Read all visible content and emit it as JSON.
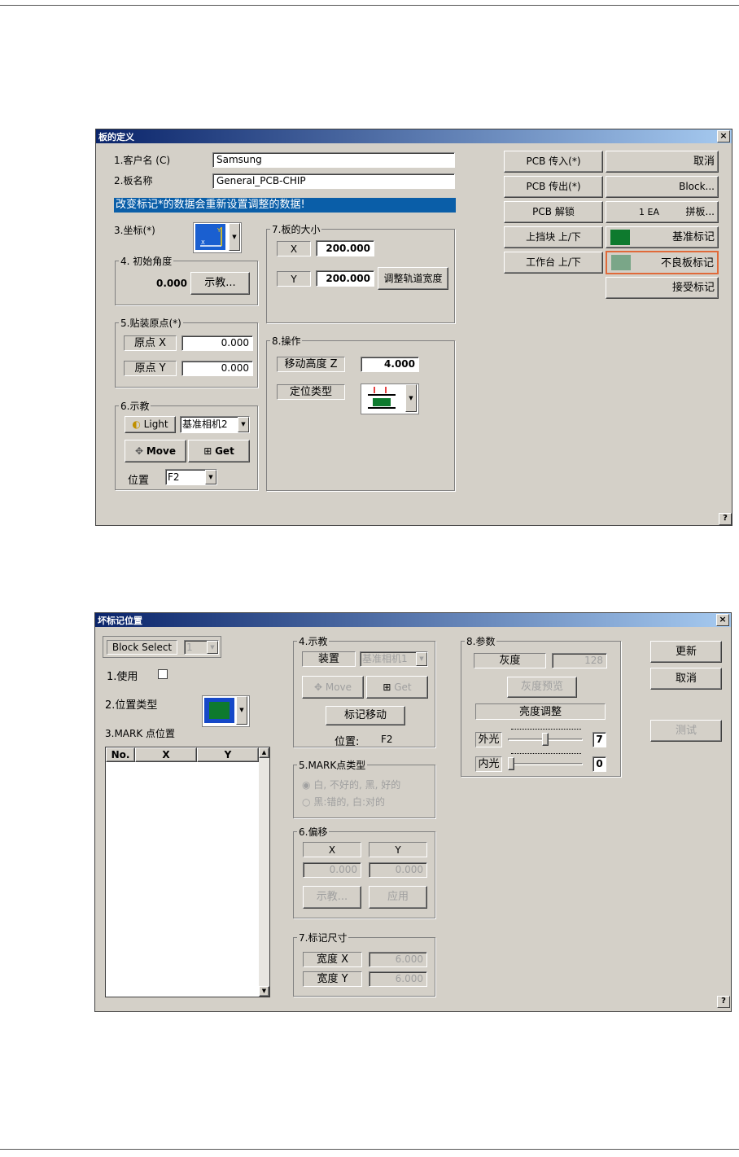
{
  "dialog1": {
    "title": "板的定义",
    "customer_label": "1.客户名 (C)",
    "customer_value": "Samsung",
    "board_name_label": "2.板名称",
    "board_name_value": "General_PCB-CHIP",
    "warning_banner": "改变标记*的数据会重新设置调整的数据!",
    "coord_label": "3.坐标(*)",
    "angle_group": "4. 初始角度",
    "angle_value": "0.000",
    "teach_button": "示教...",
    "origin_group": "5.贴装原点(*)",
    "origin_x_label": "原点 X",
    "origin_x_value": "0.000",
    "origin_y_label": "原点 Y",
    "origin_y_value": "0.000",
    "teach_group": "6.示教",
    "light_button": "Light",
    "camera_select": "基准相机2",
    "move_button": "Move",
    "get_button": "Get",
    "position_label": "位置",
    "position_select": "F2",
    "size_group": "7.板的大小",
    "x_label": "X",
    "x_value": "200.000",
    "y_label": "Y",
    "y_value": "200.000",
    "adjust_rail_button": "调整轨道宽度",
    "operation_group": "8.操作",
    "move_height_label": "移动高度 Z",
    "move_height_value": "4.000",
    "locate_type_label": "定位类型",
    "buttons_left": [
      "PCB 传入(*)",
      "PCB 传出(*)",
      "PCB 解锁",
      "上挡块 上/下",
      "工作台 上/下"
    ],
    "cancel_button": "取消",
    "block_button": "Block...",
    "panel_count": "1 EA",
    "panel_button": "拼板...",
    "fiducial_button": "基准标记",
    "bad_board_button": "不良板标记",
    "accept_button": "接受标记",
    "help": "?"
  },
  "dialog2": {
    "title": "坏标记位置",
    "block_select_label": "Block Select",
    "block_select_value": "1",
    "use_label": "1.使用",
    "position_type_label": "2.位置类型",
    "mark_pos_label": "3.MARK 点位置",
    "table_headers": [
      "No.",
      "X",
      "Y"
    ],
    "teach_group": "4.示教",
    "device_label": "装置",
    "camera_select": "基准相机1",
    "move_button": "Move",
    "get_button": "Get",
    "mark_move_button": "标记移动",
    "position_label": "位置:",
    "position_value": "F2",
    "mark_type_group": "5.MARK点类型",
    "mark_type_opt1": "白, 不好的, 黑, 好的",
    "mark_type_opt2": "黑:错的, 白:对的",
    "offset_group": "6.偏移",
    "offset_x_label": "X",
    "offset_y_label": "Y",
    "offset_x_value": "0.000",
    "offset_y_value": "0.000",
    "offset_teach_button": "示教...",
    "offset_apply_button": "应用",
    "mark_size_group": "7.标记尺寸",
    "width_x_label": "宽度 X",
    "width_x_value": "6.000",
    "width_y_label": "宽度 Y",
    "width_y_value": "6.000",
    "param_group": "8.参数",
    "gray_label": "灰度",
    "gray_value": "128",
    "gray_preview_button": "灰度预览",
    "brightness_label": "亮度调整",
    "outer_light_label": "外光",
    "outer_light_value": "7",
    "inner_light_label": "内光",
    "inner_light_value": "0",
    "update_button": "更新",
    "cancel_button": "取消",
    "test_button": "测试",
    "help": "?"
  },
  "colors": {
    "dialog_bg": "#d4d0c8",
    "title_bar": "#0a246a",
    "banner": "#0a5ea8",
    "mark_green": "#0e7a2e",
    "highlight_border": "#e06a3a"
  },
  "controls": {
    "outer_light_level": 0.5,
    "inner_light_level": 0.0
  }
}
